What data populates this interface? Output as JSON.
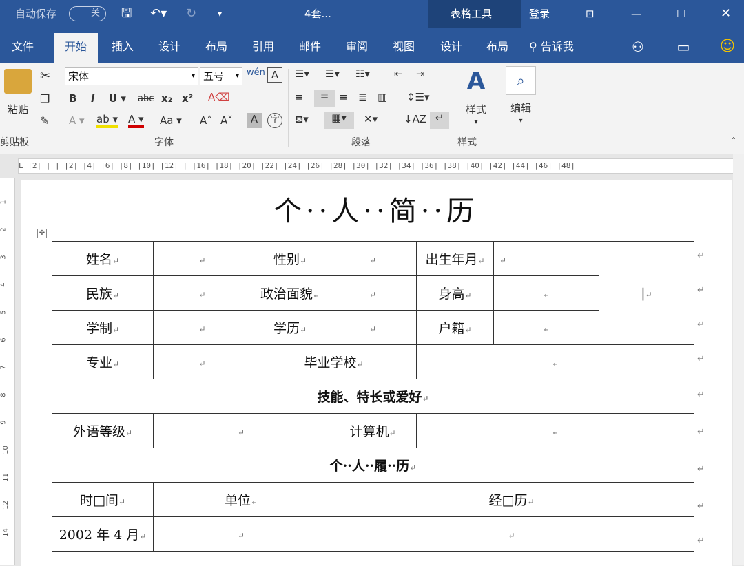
{
  "titlebar": {
    "autosave_label": "自动保存",
    "autosave_state": "关",
    "doc_name": "4套...",
    "context_group": "表格工具",
    "login_label": "登录"
  },
  "tabs": [
    "文件",
    "开始",
    "插入",
    "设计",
    "布局",
    "引用",
    "邮件",
    "审阅",
    "视图",
    "设计",
    "布局",
    "告诉我"
  ],
  "ribbon": {
    "paste_label": "粘贴",
    "font_name": "宋体",
    "font_size": "五号",
    "styles_label": "样式",
    "edit_label": "编辑",
    "groups": [
      "剪贴板",
      "字体",
      "段落",
      "样式"
    ]
  },
  "ruler_text": "L  |2|  |  |  |2|  |4|  |6|  |8|  |10|  |12|  |  |16|  |18|  |20|  |22|  |24|  |26|  |28|  |30|  |32|  |34|  |36|  |38|  |40|  |42|  |44|  |46|  |48|",
  "doc": {
    "title": "个··人··简··历",
    "para_mark": "↵",
    "rows": {
      "r1": [
        "姓名",
        "性别",
        "出生年月"
      ],
      "r2": [
        "民族",
        "政治面貌",
        "身高"
      ],
      "r3": [
        "学制",
        "学历",
        "户籍"
      ],
      "r4": [
        "专业",
        "毕业学校"
      ],
      "r5": "技能、特长或爱好",
      "r6": [
        "外语等级",
        "计算机"
      ],
      "r7": "个··人··履··历",
      "r8": [
        "时□间",
        "单位",
        "经□历"
      ],
      "r9": [
        "2002 年 4 月"
      ]
    }
  },
  "colors": {
    "accent": "#2b579a",
    "context": "#1e4379"
  }
}
